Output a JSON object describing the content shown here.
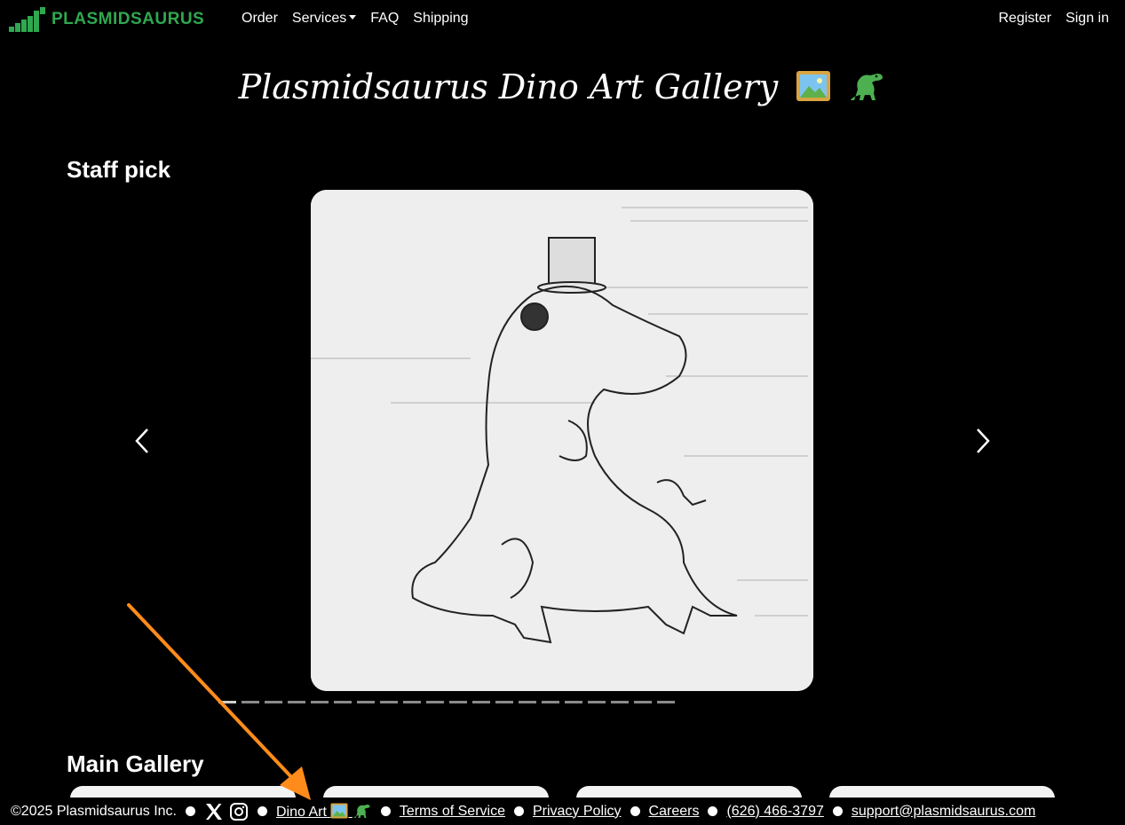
{
  "nav": {
    "brand_part1": "PLASMID",
    "brand_part2": "SAURUS",
    "order": "Order",
    "services": "Services",
    "faq": "FAQ",
    "shipping": "Shipping",
    "register": "Register",
    "sign_in": "Sign in"
  },
  "page": {
    "title": "Plasmidsaurus Dino Art Gallery",
    "staff_pick_heading": "Staff pick",
    "main_gallery_heading": "Main Gallery"
  },
  "carousel": {
    "indicator_count": 20,
    "active_index": 0
  },
  "footer": {
    "copyright": "©2025 Plasmidsaurus Inc.",
    "dino_art": "Dino Art",
    "terms": "Terms of Service",
    "privacy": "Privacy Policy",
    "careers": "Careers",
    "phone": "(626) 466-3797",
    "email": "support@plasmidsaurus.com"
  },
  "colors": {
    "brand_green": "#2fa84f",
    "annotation_arrow": "#ff8c1a",
    "background": "#000000"
  },
  "icons": [
    "plasmidsaurus-logo-icon",
    "chevron-down-icon",
    "framed-picture-icon",
    "dinosaur-icon",
    "carousel-prev-icon",
    "carousel-next-icon",
    "x-twitter-icon",
    "instagram-icon"
  ]
}
